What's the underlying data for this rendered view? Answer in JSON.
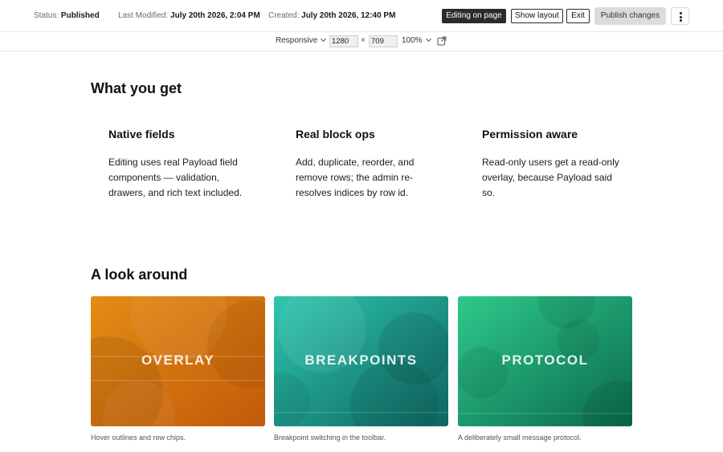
{
  "topbar": {
    "status_label": "Status:",
    "status_value": "Published",
    "modified_label": "Last Modified:",
    "modified_value": "July 20th 2026, 2:04 PM",
    "created_label": "Created:",
    "created_value": "July 20th 2026, 12:40 PM",
    "editing_label": "Editing on page",
    "show_layout_label": "Show layout",
    "exit_label": "Exit",
    "publish_label": "Publish changes",
    "more_icon": "kebab-menu-icon"
  },
  "breakpoint_bar": {
    "mode": "Responsive",
    "width": "1280",
    "times": "×",
    "height": "709",
    "zoom": "100%",
    "open_icon": "external-link-icon"
  },
  "content": {
    "section1_title": "What you get",
    "features": [
      {
        "title": "Native fields",
        "body": "Editing uses real Payload field components — validation, drawers, and rich text included."
      },
      {
        "title": "Real block ops",
        "body": "Add, duplicate, reorder, and remove rows; the admin re-resolves indices by row id."
      },
      {
        "title": "Permission aware",
        "body": "Read-only users get a read-only overlay, because Payload said so."
      }
    ],
    "section2_title": "A look around",
    "cards": [
      {
        "label": "OVERLAY",
        "caption": "Hover outlines and row chips.",
        "color_start": "#e08a12",
        "color_end": "#c4600a"
      },
      {
        "label": "BREAKPOINTS",
        "caption": "Breakpoint switching in the toolbar.",
        "color_start": "#2bbfa8",
        "color_end": "#0d6b63"
      },
      {
        "label": "PROTOCOL",
        "caption": "A deliberately small message protocol.",
        "color_start": "#2cc48a",
        "color_end": "#0a6b4d"
      }
    ]
  }
}
